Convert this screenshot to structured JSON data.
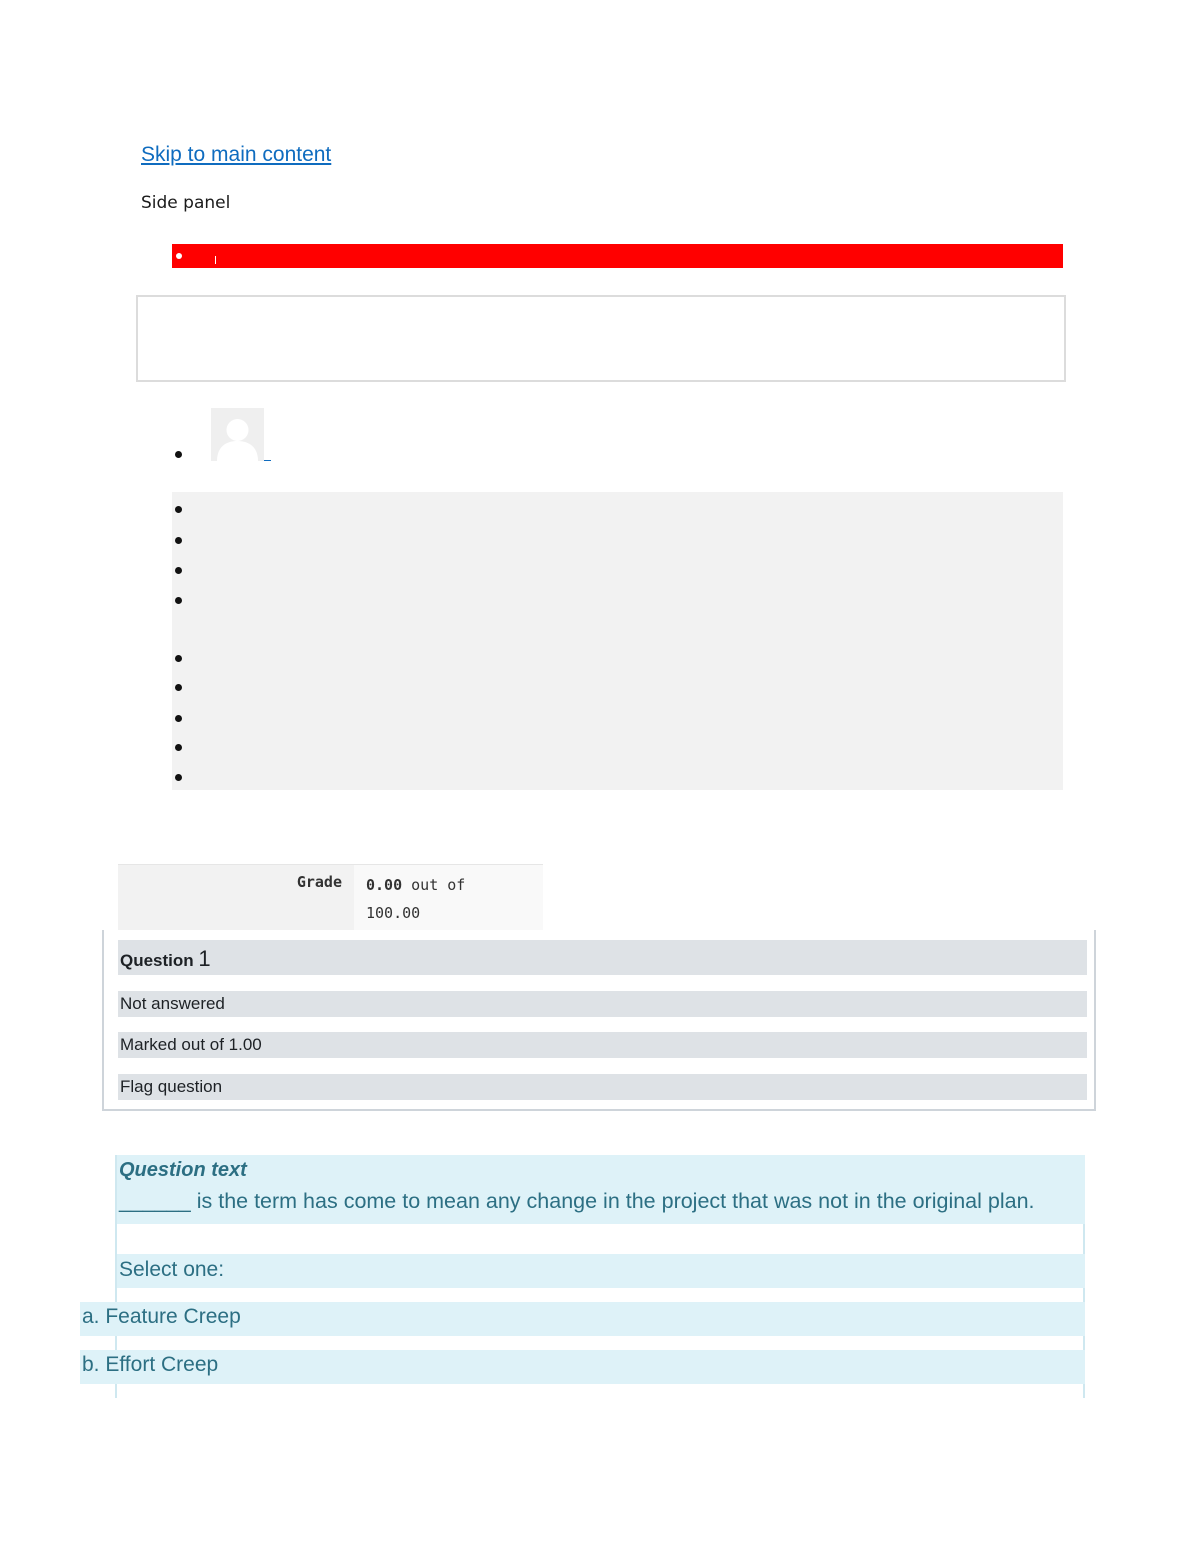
{
  "header": {
    "skip_link": "Skip to main content",
    "side_panel": "Side panel"
  },
  "colors": {
    "accent_red": "#ff0000",
    "link_blue": "#0f6cbf",
    "question_text": "#2c6f83",
    "question_bg": "#def2f8",
    "info_bg": "#dee2e6"
  },
  "icons": {
    "avatar": "user-avatar-icon"
  },
  "grade": {
    "label": "Grade",
    "value": "0.00",
    "suffix_1": " out of",
    "suffix_2": "100.00"
  },
  "question": {
    "label": "Question ",
    "number": "1",
    "status": "Not answered",
    "marked": "Marked out of 1.00",
    "flag": "Flag question",
    "text_title": "Question text",
    "text_body": "______ is the term has come to mean any change in the project that was not in the original plan.",
    "select_prompt": "Select one:",
    "options": [
      "a. Feature Creep",
      "b. Effort Creep"
    ]
  }
}
